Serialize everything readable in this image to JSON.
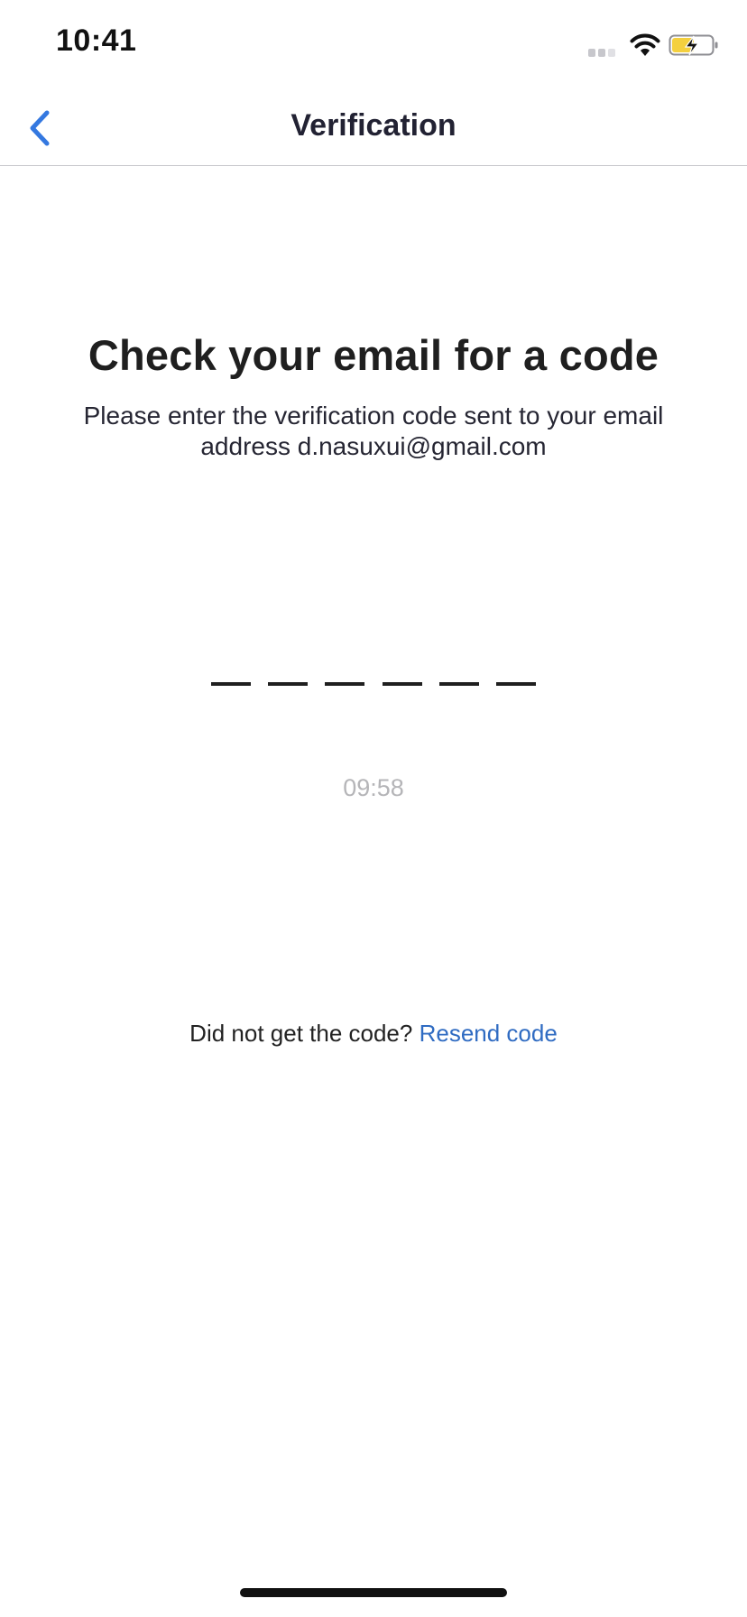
{
  "status_bar": {
    "time": "10:41",
    "icons": [
      "signal-icon",
      "wifi-icon",
      "battery-charging-icon"
    ],
    "battery_fill_color": "#F4D03F"
  },
  "nav": {
    "title": "Verification",
    "back_icon": "chevron-left-icon",
    "accent_color": "#3478E0"
  },
  "main": {
    "headline": "Check your email for a code",
    "subtext": "Please enter the verification code sent to your email address d.nasuxui@gmail.com",
    "code_slots": [
      "",
      "",
      "",
      "",
      "",
      ""
    ],
    "timer": "09:58",
    "resend_prompt": "Did not get the code?",
    "resend_link": "Resend code",
    "link_color": "#2F6BC2"
  }
}
